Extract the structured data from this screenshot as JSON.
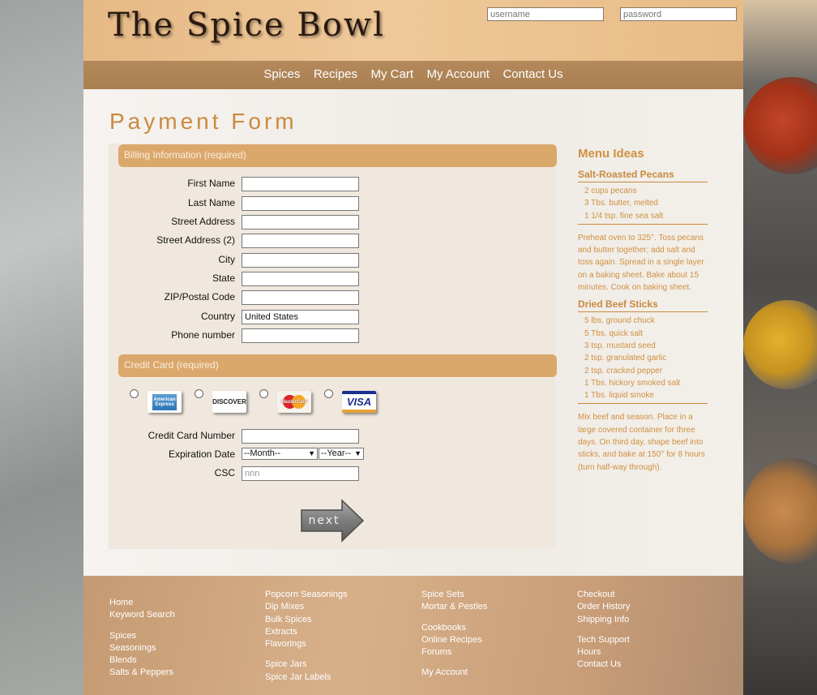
{
  "header": {
    "logo_text": "The Spice Bowl",
    "username_placeholder": "username",
    "password_placeholder": "password"
  },
  "nav": [
    "Spices",
    "Recipes",
    "My Cart",
    "My Account",
    "Contact Us"
  ],
  "page_title": "Payment Form",
  "billing": {
    "section_label": "Billing Information (required)",
    "fields": [
      {
        "label": "First Name",
        "value": ""
      },
      {
        "label": "Last Name",
        "value": ""
      },
      {
        "label": "Street Address",
        "value": ""
      },
      {
        "label": "Street Address (2)",
        "value": ""
      },
      {
        "label": "City",
        "value": ""
      },
      {
        "label": "State",
        "value": ""
      },
      {
        "label": "ZIP/Postal Code",
        "value": ""
      },
      {
        "label": "Country",
        "value": "United States"
      },
      {
        "label": "Phone number",
        "value": ""
      }
    ]
  },
  "credit": {
    "section_label": "Credit Card (required)",
    "cards": [
      "American Express",
      "DISCOVER",
      "MasterCard",
      "VISA"
    ],
    "card_number_label": "Credit Card Number",
    "expiration_label": "Expiration Date",
    "month_selected": "--Month--",
    "year_selected": "--Year--",
    "csc_label": "CSC",
    "csc_placeholder": "nnn"
  },
  "next_button_label": "next",
  "sidebar": {
    "title": "Menu Ideas",
    "recipes": [
      {
        "name": "Salt-Roasted Pecans",
        "ingredients": [
          "2 cups pecans",
          "3 Tbs. butter, melted",
          "1 1/4 tsp. fine sea salt"
        ],
        "directions": "Preheat oven to 325°. Toss pecans and butter together; add salt and toss again. Spread in a single layer on a baking sheet. Bake about 15 minutes. Cook on baking sheet."
      },
      {
        "name": "Dried Beef Sticks",
        "ingredients": [
          "5 lbs. ground chuck",
          "5 Tbs. quick salt",
          "3 tsp. mustard seed",
          "2 tsp. granulated garlic",
          "2 tsp. cracked pepper",
          "1 Tbs. hickory smoked salt",
          "1 Tbs. liquid smoke"
        ],
        "directions": "Mix beef and season. Place in a large covered container for three days. On third day, shape beef into sticks, and bake at 150° for 8 hours (turn half-way through)."
      }
    ]
  },
  "footer": {
    "col1": [
      [
        "Home",
        "Keyword Search"
      ],
      [
        "Spices",
        "Seasonings",
        "Blends",
        "Salts & Peppers"
      ]
    ],
    "col2": [
      [
        "Popcorn Seasonings",
        "Dip Mixes",
        "Bulk Spices",
        "Extracts",
        "Flavorings"
      ],
      [
        "Spice Jars",
        "Spice Jar Labels"
      ]
    ],
    "col3": [
      [
        "Spice Sets",
        "Mortar & Pestles"
      ],
      [
        "Cookbooks",
        "Online Recipes",
        "Forums"
      ],
      [
        "My Account"
      ]
    ],
    "col4": [
      [
        "Checkout",
        "Order History",
        "Shipping Info"
      ],
      [
        "Tech Support",
        "Hours",
        "Contact Us"
      ]
    ]
  }
}
